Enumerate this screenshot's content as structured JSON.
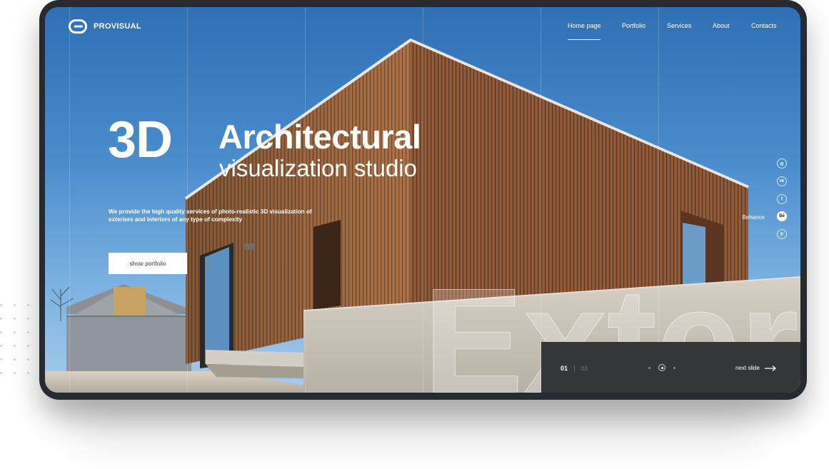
{
  "brand": {
    "name": "PROVISUAL",
    "logo_icon": "provisual-logo"
  },
  "nav": {
    "items": [
      "Home page",
      "Portfolio",
      "Services",
      "About",
      "Contacts"
    ],
    "active_index": 0
  },
  "hero": {
    "title_big": "3D",
    "title_line1": "Architectural",
    "title_line2": "visualization studio",
    "description": "We provide the high quality services of photo-realistic 3D visualization of exteriors and interiors of any type of complexity",
    "cta_label": "show portfolio",
    "watermark": "Exter"
  },
  "social": {
    "items": [
      {
        "icon": "instagram-icon",
        "glyph": "◎"
      },
      {
        "icon": "vk-icon",
        "glyph": "vk"
      },
      {
        "icon": "facebook-icon",
        "glyph": "f"
      },
      {
        "icon": "behance-icon",
        "glyph": "Bē",
        "label": "Behance",
        "active": true
      },
      {
        "icon": "pinterest-icon",
        "glyph": "p"
      }
    ]
  },
  "slider": {
    "current": "01",
    "total": "03",
    "next_label": "next slide",
    "active_dot": 1,
    "dot_count": 3
  },
  "colors": {
    "accent": "#ffffff",
    "panel": "#34363a",
    "device": "#262a31",
    "sky": "#4a8ccc",
    "wood": "#a16a42",
    "concrete": "#c9c3b8"
  }
}
